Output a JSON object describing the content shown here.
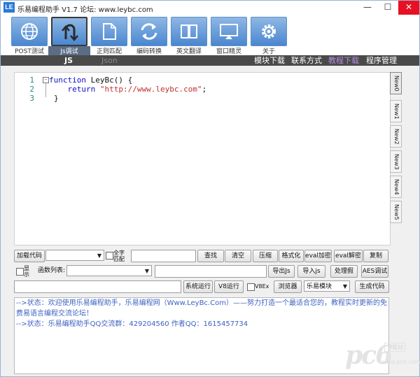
{
  "window": {
    "title": "乐易编程助手 V1.7 论坛: www.leybc.com",
    "icon_text": "LE",
    "min_symbol": "—",
    "max_symbol": "☐",
    "close_symbol": "✕"
  },
  "toolbar": {
    "items": [
      {
        "label": "POST测试",
        "icon": "globe-icon"
      },
      {
        "label": "Js调试",
        "icon": "u-turn-icon"
      },
      {
        "label": "正则匹配",
        "icon": "document-icon"
      },
      {
        "label": "编码转换",
        "icon": "sync-icon"
      },
      {
        "label": "英文翻译",
        "icon": "book-icon"
      },
      {
        "label": "窗口精灵",
        "icon": "monitor-icon"
      },
      {
        "label": "关于",
        "icon": "gear-icon"
      }
    ],
    "active_index": 1
  },
  "tabs": {
    "js": "JS",
    "json": "Json"
  },
  "nav": {
    "module_download": "模块下载",
    "contact": "联系方式",
    "tutorial_download": "教程下载",
    "program_manage": "程序管理",
    "tutorial_color": "#b78be0"
  },
  "editor": {
    "line_numbers": [
      "1",
      "2",
      "3"
    ],
    "fold_symbol": "−",
    "line1_kw": "function",
    "line1_rest": " LeyBc() {",
    "line2_kw": "    return",
    "line2_str": " \"http://www.leybc.com\"",
    "line2_end": ";",
    "line3": "}"
  },
  "side_tabs": [
    "New0",
    "New1",
    "New2",
    "New3",
    "New4",
    "New5"
  ],
  "row1": {
    "load_code": "加载代码",
    "full_match": "全字匹配",
    "find": "查找",
    "clear": "清空",
    "compress": "压缩",
    "format": "格式化",
    "eval_encrypt": "eval加密",
    "eval_decrypt": "eval解密",
    "copy": "复制"
  },
  "row2": {
    "show": "显示",
    "func_list": "函数列表:",
    "export_js": "导出Js",
    "import_js": "导入js",
    "handle_fake": "处理假",
    "aes_debug": "AES调试"
  },
  "row3": {
    "system_run": "系统运行",
    "v8_run": "V8运行",
    "v8ex": "V8Ex",
    "browser": "浏览器",
    "module_select": "乐易模块",
    "generate_code": "生成代码"
  },
  "log": {
    "lines": [
      "-->状态：欢迎使用乐易编程助手，乐易编程网（Www.LeyBc.Com）——努力打造一个最适合您的，教程实时更新的免费易语言编程交流论坛！",
      "-->状态：乐易编程助手QQ交流群：429204560 作者QQ：1615457734"
    ],
    "color": "#3d62c2"
  },
  "watermark": {
    "logo": "pc6",
    "box": "下载站",
    "url": "www.pc6.com"
  }
}
